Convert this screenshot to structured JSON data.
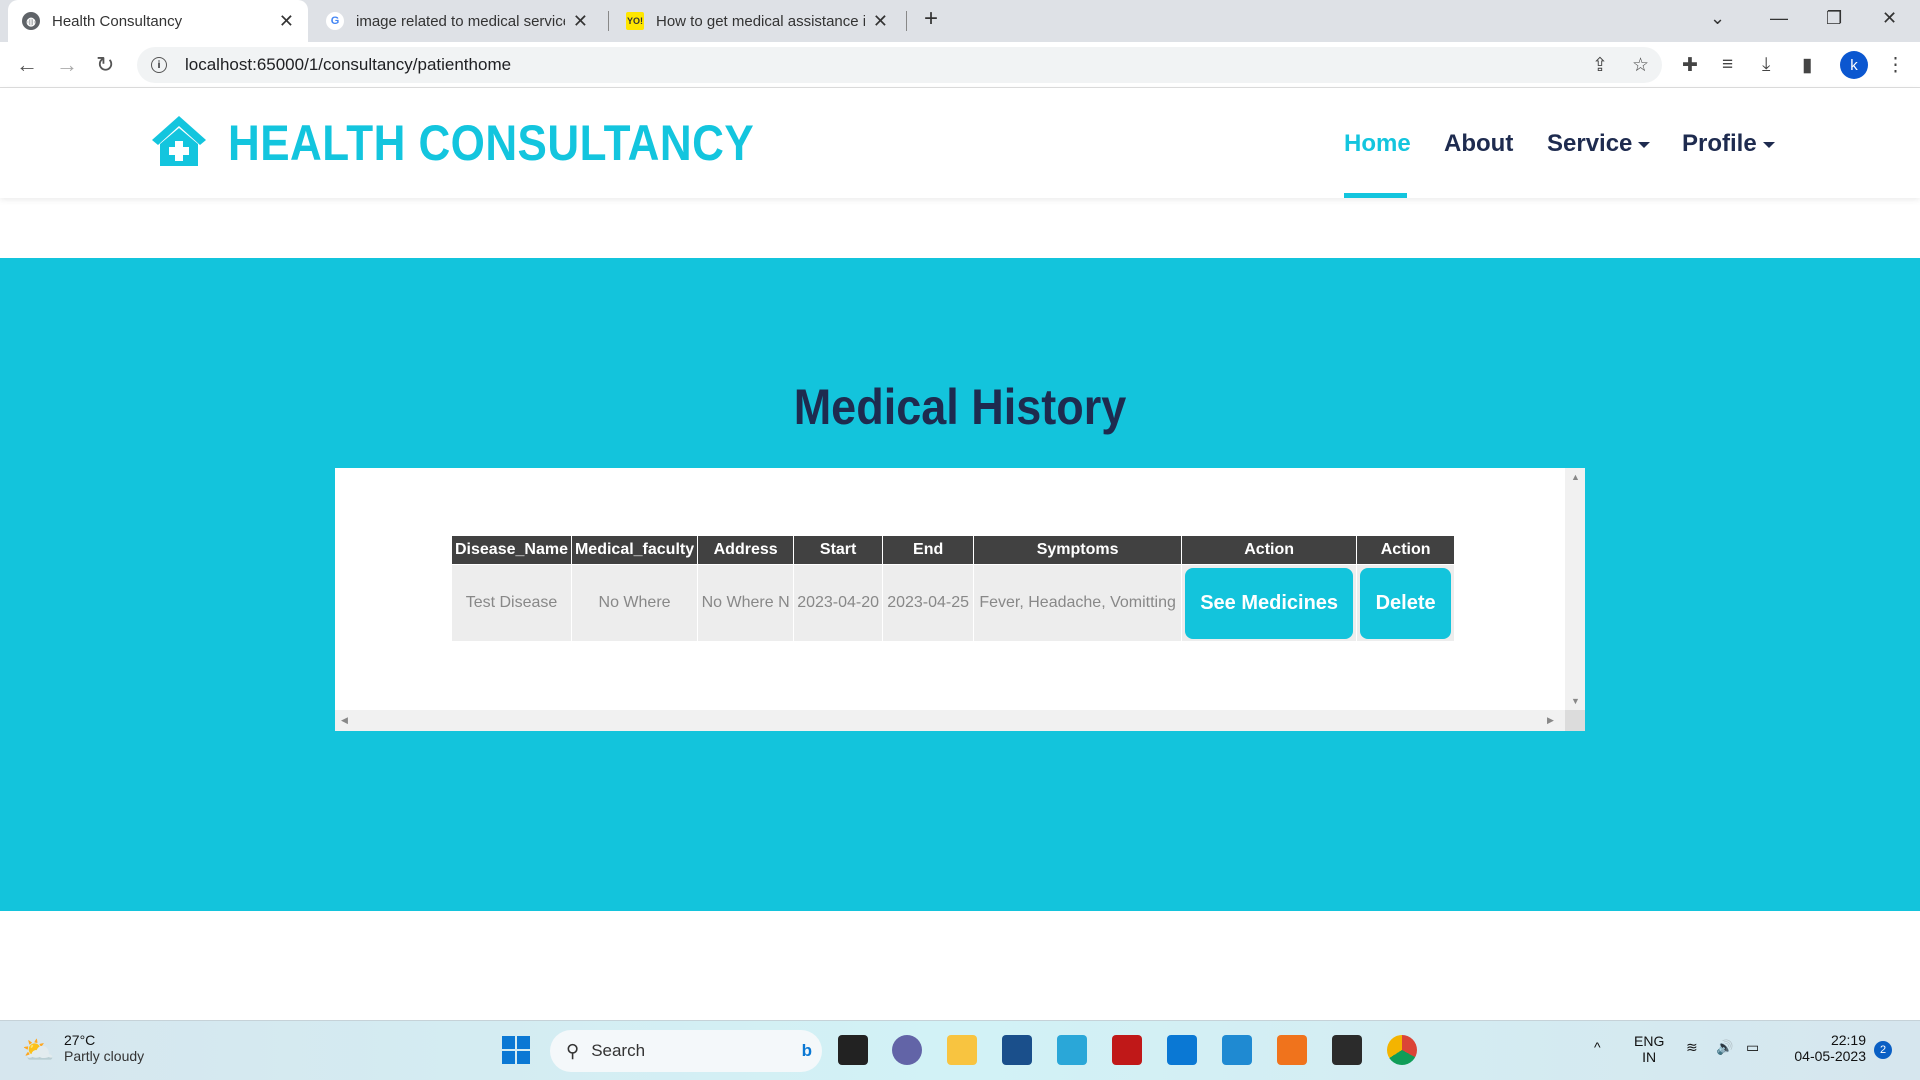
{
  "browser": {
    "tabs": [
      {
        "title": "Health Consultancy",
        "icon": "globe-icon"
      },
      {
        "title": "image related to medical services",
        "icon": "google-icon"
      },
      {
        "title": "How to get medical assistance in",
        "icon": "yo-icon",
        "icon_text": "YO!"
      }
    ],
    "url": "localhost:65000/1/consultancy/patienthome",
    "profile_initial": "k"
  },
  "navbar": {
    "brand": "HEALTH CONSULTANCY",
    "items": [
      {
        "label": "Home",
        "active": true
      },
      {
        "label": "About"
      },
      {
        "label": "Service",
        "dropdown": true
      },
      {
        "label": "Profile",
        "dropdown": true
      }
    ]
  },
  "main": {
    "title": "Medical History",
    "table": {
      "headers": [
        "Disease_Name",
        "Medical_faculty",
        "Address",
        "Start",
        "End",
        "Symptoms",
        "Action",
        "Action"
      ],
      "rows": [
        {
          "disease": "Test Disease",
          "faculty": "No Where",
          "address": "No Where N",
          "start": "2023-04-20",
          "end": "2023-04-25",
          "symptoms": "Fever, Headache, Vomitting",
          "see_label": "See Medicines",
          "delete_label": "Delete"
        }
      ]
    }
  },
  "taskbar": {
    "weather_temp": "27°C",
    "weather_desc": "Partly cloudy",
    "search_placeholder": "Search",
    "lang1": "ENG",
    "lang2": "IN",
    "time": "22:19",
    "date": "04-05-2023",
    "notifications": "2"
  },
  "colors": {
    "accent": "#13c4dc",
    "dark": "#1e2b4f",
    "header": "#414141"
  }
}
